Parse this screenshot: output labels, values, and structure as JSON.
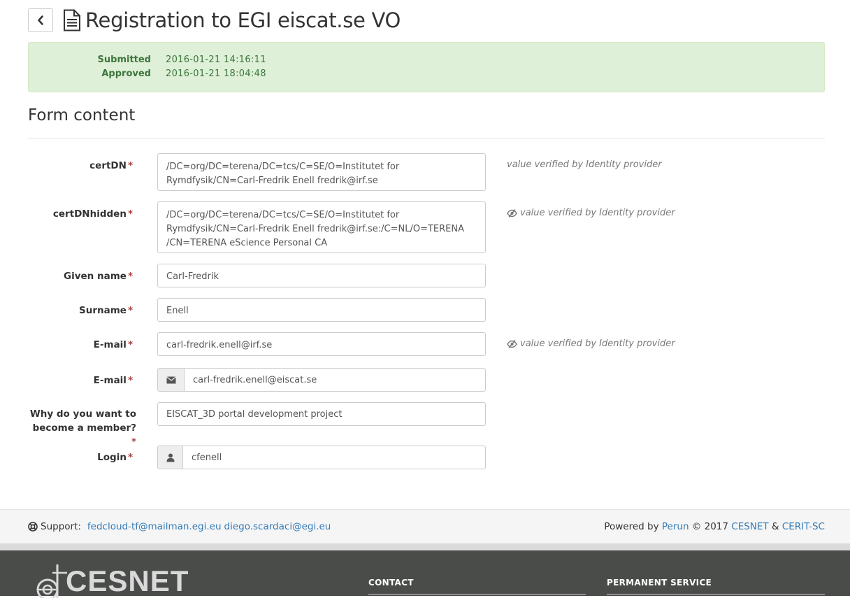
{
  "header": {
    "back_icon": "chevron-left-icon",
    "doc_icon": "file-text-icon",
    "title": "Registration to EGI eiscat.se VO"
  },
  "status": {
    "submitted_label": "Submitted",
    "submitted_value": "2016-01-21 14:16:11",
    "approved_label": "Approved",
    "approved_value": "2016-01-21 18:04:48",
    "color": "#3c763d",
    "background": "#dff0d8"
  },
  "form": {
    "heading": "Form content",
    "required_marker": "*",
    "fields": {
      "certdn": {
        "label": "certDN",
        "value": "/DC=org/DC=terena/DC=tcs/C=SE/O=Institutet for Rymdfysik/CN=Carl-Fredrik Enell fredrik@irf.se",
        "note": "value verified by Identity provider"
      },
      "certdnhidden": {
        "label": "certDNhidden",
        "value": "/DC=org/DC=terena/DC=tcs/C=SE/O=Institutet for Rymdfysik/CN=Carl-Fredrik Enell fredrik@irf.se:/C=NL/O=TERENA /CN=TERENA eScience Personal CA",
        "note": "value verified by Identity provider",
        "note_icon": "eye-slash-icon"
      },
      "given_name": {
        "label": "Given name",
        "value": "Carl-Fredrik"
      },
      "surname": {
        "label": "Surname",
        "value": "Enell"
      },
      "email_federated": {
        "label": "E-mail",
        "value": "carl-fredrik.enell@irf.se",
        "note": "value verified by Identity provider",
        "note_icon": "eye-slash-icon"
      },
      "email": {
        "label": "E-mail",
        "value": "carl-fredrik.enell@eiscat.se",
        "icon": "envelope-icon"
      },
      "reason": {
        "label_line1": "Why do you want to",
        "label_line2": "become a member?",
        "value": "EISCAT_3D portal development project"
      },
      "login": {
        "label": "Login",
        "value": "cfenell",
        "icon": "user-icon"
      }
    }
  },
  "support": {
    "icon": "life-ring-icon",
    "label": "Support:",
    "email1": "fedcloud-tf@mailman.egi.eu",
    "email2": "diego.scardaci@egi.eu",
    "powered_prefix": "Powered by",
    "perun": "Perun",
    "copyright": "© 2017",
    "cesnet": "CESNET",
    "amp": "&",
    "cerit": "CERIT-SC",
    "link_color": "#337ab7"
  },
  "footer": {
    "logo_text": "CESNET",
    "col1_heading": "CONTACT",
    "col2_heading": "PERMANENT SERVICE"
  }
}
